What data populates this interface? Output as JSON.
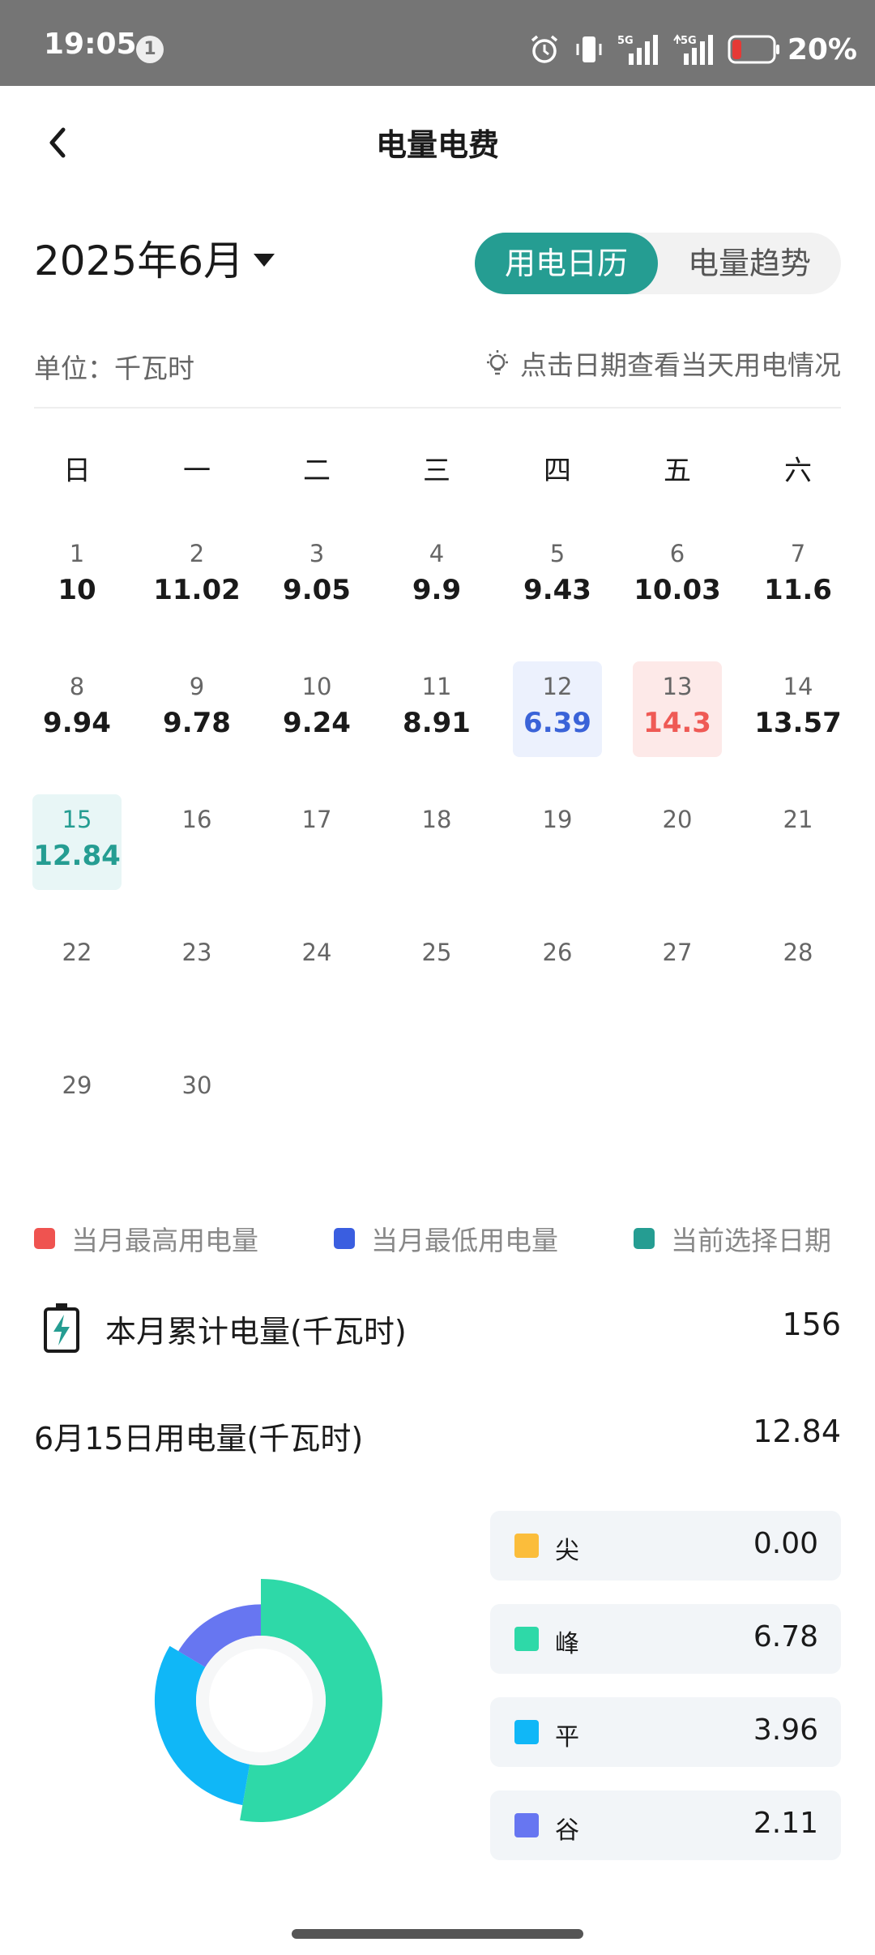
{
  "status_bar": {
    "time": "19:05",
    "notification_count": "1",
    "battery_pct": "20%",
    "network_5g_1": "5G",
    "network_5g_2": "5G"
  },
  "header": {
    "title": "电量电费"
  },
  "month": {
    "label": "2025年6月"
  },
  "tabs": [
    {
      "label": "用电日历",
      "active": true
    },
    {
      "label": "电量趋势",
      "active": false
    }
  ],
  "unit": {
    "label": "单位：千瓦时"
  },
  "hint": {
    "text": "点击日期查看当天用电情况"
  },
  "calendar": {
    "weekdays": [
      "日",
      "一",
      "二",
      "三",
      "四",
      "五",
      "六"
    ],
    "days": [
      {
        "day": "1",
        "value": "10"
      },
      {
        "day": "2",
        "value": "11.02"
      },
      {
        "day": "3",
        "value": "9.05"
      },
      {
        "day": "4",
        "value": "9.9"
      },
      {
        "day": "5",
        "value": "9.43"
      },
      {
        "day": "6",
        "value": "10.03"
      },
      {
        "day": "7",
        "value": "11.6"
      },
      {
        "day": "8",
        "value": "9.94"
      },
      {
        "day": "9",
        "value": "9.78"
      },
      {
        "day": "10",
        "value": "9.24"
      },
      {
        "day": "11",
        "value": "8.91"
      },
      {
        "day": "12",
        "value": "6.39",
        "state": "low"
      },
      {
        "day": "13",
        "value": "14.3",
        "state": "high"
      },
      {
        "day": "14",
        "value": "13.57"
      },
      {
        "day": "15",
        "value": "12.84",
        "state": "selected"
      },
      {
        "day": "16",
        "value": ""
      },
      {
        "day": "17",
        "value": ""
      },
      {
        "day": "18",
        "value": ""
      },
      {
        "day": "19",
        "value": ""
      },
      {
        "day": "20",
        "value": ""
      },
      {
        "day": "21",
        "value": ""
      },
      {
        "day": "22",
        "value": ""
      },
      {
        "day": "23",
        "value": ""
      },
      {
        "day": "24",
        "value": ""
      },
      {
        "day": "25",
        "value": ""
      },
      {
        "day": "26",
        "value": ""
      },
      {
        "day": "27",
        "value": ""
      },
      {
        "day": "28",
        "value": ""
      },
      {
        "day": "29",
        "value": ""
      },
      {
        "day": "30",
        "value": ""
      }
    ]
  },
  "legend": [
    {
      "label": "当月最高用电量",
      "color": "#ef5350"
    },
    {
      "label": "当月最低用电量",
      "color": "#3a5ee0"
    },
    {
      "label": "当前选择日期",
      "color": "#259d92"
    }
  ],
  "monthly_total": {
    "label": "本月累计电量(千瓦时)",
    "value": "156"
  },
  "daily_total": {
    "label": "6月15日用电量(千瓦时)",
    "value": "12.84"
  },
  "breakdown": [
    {
      "label": "尖",
      "value": "0.00",
      "color": "#fbbd3b"
    },
    {
      "label": "峰",
      "value": "6.78",
      "color": "#2ed9a8"
    },
    {
      "label": "平",
      "value": "3.96",
      "color": "#10b7f7"
    },
    {
      "label": "谷",
      "value": "2.11",
      "color": "#6776f1"
    }
  ],
  "colors": {
    "accent": "#259d92",
    "status_bar": "#757575"
  }
}
